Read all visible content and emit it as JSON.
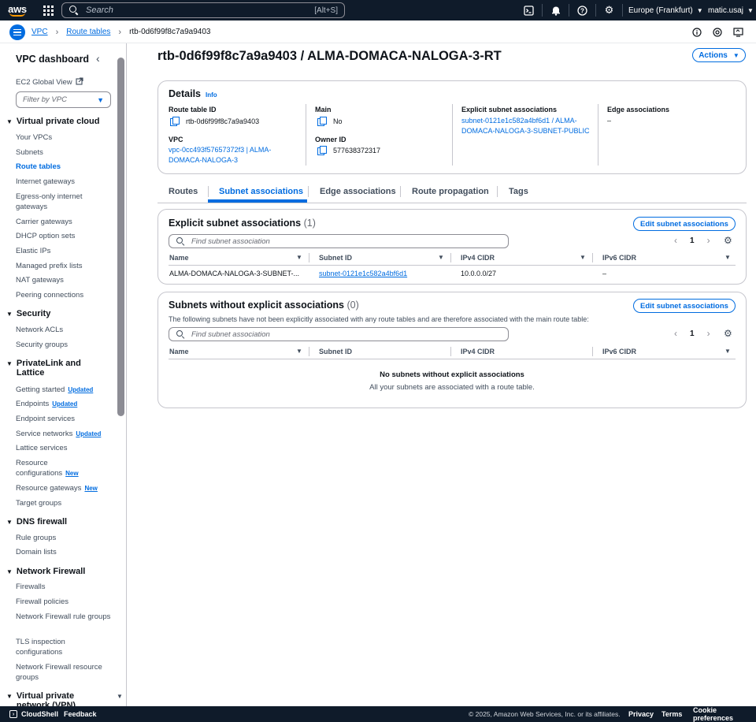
{
  "topnav": {
    "search_placeholder": "Search",
    "search_shortcut": "[Alt+S]",
    "region": "Europe (Frankfurt)",
    "user": "matic.usaj"
  },
  "breadcrumb": {
    "items": [
      "VPC",
      "Route tables"
    ],
    "current": "rtb-0d6f99f8c7a9a9403"
  },
  "sidebar": {
    "title": "VPC dashboard",
    "ec2_global_view": "EC2 Global View",
    "filter_placeholder": "Filter by VPC",
    "sections": [
      {
        "title": "Virtual private cloud",
        "items": [
          "Your VPCs",
          "Subnets",
          "Route tables",
          "Internet gateways",
          "Egress-only internet gateways",
          "Carrier gateways",
          "DHCP option sets",
          "Elastic IPs",
          "Managed prefix lists",
          "NAT gateways",
          "Peering connections"
        ]
      },
      {
        "title": "Security",
        "items": [
          "Network ACLs",
          "Security groups"
        ]
      },
      {
        "title": "PrivateLink and Lattice",
        "items": [
          "Getting started",
          "Endpoints",
          "Endpoint services",
          "Service networks",
          "Lattice services",
          "Resource configurations",
          "Resource gateways",
          "Target groups"
        ]
      },
      {
        "title": "DNS firewall",
        "items": [
          "Rule groups",
          "Domain lists"
        ]
      },
      {
        "title": "Network Firewall",
        "items": [
          "Firewalls",
          "Firewall policies",
          "Network Firewall rule groups",
          "TLS inspection configurations",
          "Network Firewall resource groups"
        ]
      },
      {
        "title": "Virtual private network (VPN)",
        "items": []
      }
    ],
    "badges": {
      "updated": "Updated",
      "new": "New"
    }
  },
  "page": {
    "title": "rtb-0d6f99f8c7a9a9403 / ALMA-DOMACA-NALOGA-3-RT",
    "actions": "Actions"
  },
  "details": {
    "title": "Details",
    "info": "Info",
    "route_table_id_label": "Route table ID",
    "route_table_id": "rtb-0d6f99f8c7a9a9403",
    "vpc_label": "VPC",
    "vpc_line1": "vpc-0cc493f57657372f3 | ALMA-",
    "vpc_line2": "DOMACA-NALOGA-3",
    "main_label": "Main",
    "main": "No",
    "owner_label": "Owner ID",
    "owner": "577638372317",
    "explicit_label": "Explicit subnet associations",
    "explicit_line1": "subnet-0121e1c582a4bf6d1 / ALMA-",
    "explicit_line2": "DOMACA-NALOGA-3-SUBNET-PUBLIC",
    "edge_label": "Edge associations",
    "edge": "–"
  },
  "tabs": [
    "Routes",
    "Subnet associations",
    "Edge associations",
    "Route propagation",
    "Tags"
  ],
  "explicit": {
    "title": "Explicit subnet associations",
    "count": "(1)",
    "edit": "Edit subnet associations",
    "find_placeholder": "Find subnet association",
    "page": "1",
    "columns": [
      "Name",
      "Subnet ID",
      "IPv4 CIDR",
      "IPv6 CIDR"
    ],
    "rows": [
      {
        "name": "ALMA-DOMACA-NALOGA-3-SUBNET-...",
        "subnet": "subnet-0121e1c582a4bf6d1",
        "ipv4": "10.0.0.0/27",
        "ipv6": "–"
      }
    ]
  },
  "without": {
    "title": "Subnets without explicit associations",
    "count": "(0)",
    "edit": "Edit subnet associations",
    "description": "The following subnets have not been explicitly associated with any route tables and are therefore associated with the main route table:",
    "find_placeholder": "Find subnet association",
    "page": "1",
    "columns": [
      "Name",
      "Subnet ID",
      "IPv4 CIDR",
      "IPv6 CIDR"
    ],
    "empty_title": "No subnets without explicit associations",
    "empty_sub": "All your subnets are associated with a route table."
  },
  "footer": {
    "cloudshell": "CloudShell",
    "feedback": "Feedback",
    "copyright": "© 2025, Amazon Web Services, Inc. or its affiliates.",
    "privacy": "Privacy",
    "terms": "Terms",
    "cookies": "Cookie preferences"
  }
}
